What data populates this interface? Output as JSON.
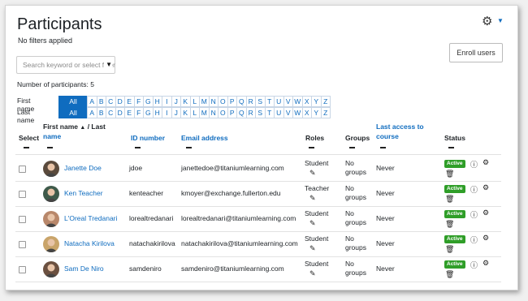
{
  "page": {
    "title": "Participants",
    "no_filters": "No filters applied",
    "enroll_button": "Enroll users",
    "search_placeholder": "Search keyword or select filter",
    "participants_count": "Number of participants: 5"
  },
  "initials": {
    "firstname_label": "First name",
    "lastname_label": "Last name",
    "all_label": "All",
    "letters": [
      "A",
      "B",
      "C",
      "D",
      "E",
      "F",
      "G",
      "H",
      "I",
      "J",
      "K",
      "L",
      "M",
      "N",
      "O",
      "P",
      "Q",
      "R",
      "S",
      "T",
      "U",
      "V",
      "W",
      "X",
      "Y",
      "Z"
    ]
  },
  "table": {
    "headers": {
      "select": "Select",
      "first_name": "First name",
      "sep": "/ Last",
      "last_name": "name",
      "id_number": "ID number",
      "email": "Email address",
      "roles": "Roles",
      "groups": "Groups",
      "last_access_1": "Last access to",
      "last_access_2": "course",
      "status": "Status"
    },
    "rows": [
      {
        "name": "Janette Doe",
        "id": "jdoe",
        "email": "janettedoe@titaniumlearning.com",
        "role": "Student",
        "groups_1": "No",
        "groups_2": "groups",
        "access": "Never",
        "status": "Active",
        "avatar_color": "#5a4a3c"
      },
      {
        "name": "Ken Teacher",
        "id": "kenteacher",
        "email": "kmoyer@exchange.fullerton.edu",
        "role": "Teacher",
        "groups_1": "No",
        "groups_2": "groups",
        "access": "Never",
        "status": "Active",
        "avatar_color": "#3e5a4a"
      },
      {
        "name": "L'Oreal Tredanari",
        "id": "lorealtredanari",
        "email": "lorealtredanari@titaniumlearning.com",
        "role": "Student",
        "groups_1": "No",
        "groups_2": "groups",
        "access": "Never",
        "status": "Active",
        "avatar_color": "#b8876a"
      },
      {
        "name": "Natacha Kirilova",
        "id": "natachakirilova",
        "email": "natachakirilova@titaniumlearning.com",
        "role": "Student",
        "groups_1": "No",
        "groups_2": "groups",
        "access": "Never",
        "status": "Active",
        "avatar_color": "#c9a46a"
      },
      {
        "name": "Sam De Niro",
        "id": "samdeniro",
        "email": "samdeniro@titaniumlearning.com",
        "role": "Student",
        "groups_1": "No",
        "groups_2": "groups",
        "access": "Never",
        "status": "Active",
        "avatar_color": "#6b5040"
      }
    ]
  },
  "icons": {
    "gear": "gear-icon",
    "caret": "caret-down-icon",
    "sort": "sort-asc-icon",
    "pencil": "pencil-icon",
    "info": "info-icon",
    "cog": "cog-icon",
    "trash": "trash-icon"
  },
  "colors": {
    "link": "#0f6cbf",
    "badge": "#2f9e28"
  }
}
